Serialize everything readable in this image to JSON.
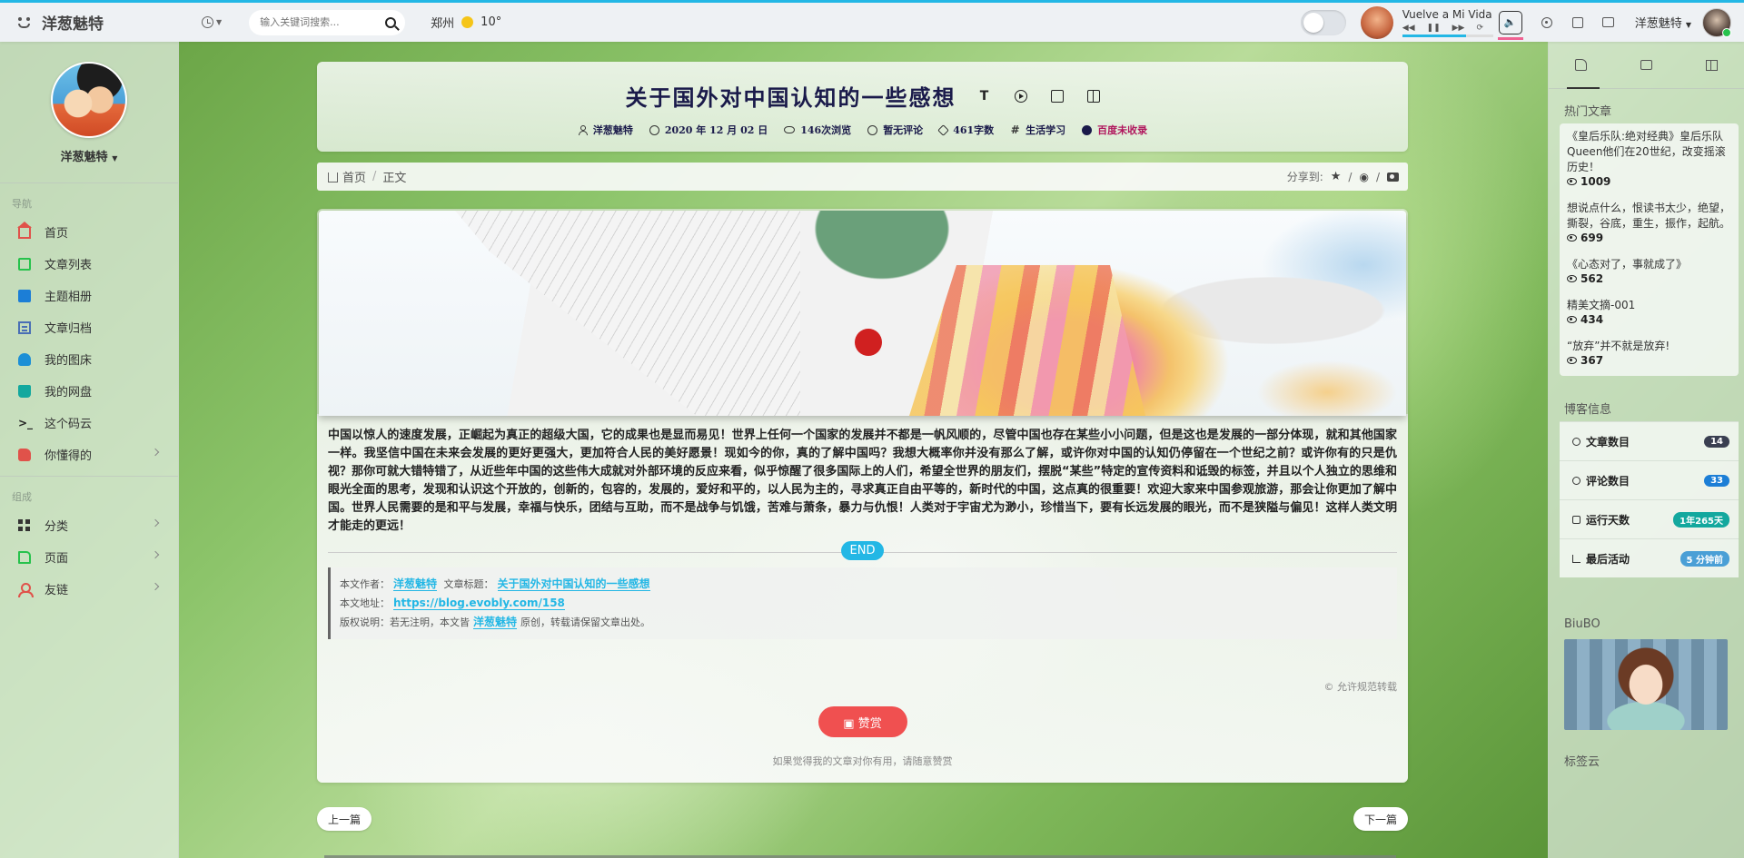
{
  "topbar": {
    "brand": "洋葱魅特",
    "search_placeholder": "输入关键词搜索...",
    "weather_city": "郑州",
    "weather_temp": "10°",
    "music_title": "Vuelve a Mi Vida",
    "user_name": "洋葱魅特"
  },
  "sidebar": {
    "profile_name": "洋葱魅特",
    "nav_label": "导航",
    "nav_items": [
      {
        "label": "首页"
      },
      {
        "label": "文章列表"
      },
      {
        "label": "主题相册"
      },
      {
        "label": "文章归档"
      },
      {
        "label": "我的图床"
      },
      {
        "label": "我的网盘"
      },
      {
        "label": "这个码云"
      },
      {
        "label": "你懂得的"
      }
    ],
    "group_label": "组成",
    "group_items": [
      {
        "label": "分类"
      },
      {
        "label": "页面"
      },
      {
        "label": "友链"
      }
    ]
  },
  "post": {
    "title": "关于国外对中国认知的一些感想",
    "meta": {
      "author": "洋葱魅特",
      "date": "2020 年 12 月 02 日",
      "views": "146次浏览",
      "comments": "暂无评论",
      "words": "461字数",
      "category": "生活学习",
      "baidu": "百度未收录"
    },
    "breadcrumb": {
      "home": "首页",
      "current": "正文"
    },
    "share_label": "分享到:",
    "body": "中国以惊人的速度发展，正崛起为真正的超级大国，它的成果也是显而易见！世界上任何一个国家的发展并不都是一帆风顺的，尽管中国也存在某些小小问题，但是这也是发展的一部分体现，就和其他国家一样。我坚信中国在未来会发展的更好更强大，更加符合人民的美好愿景！现如今的你，真的了解中国吗？我想大概率你并没有那么了解，或许你对中国的认知仍停留在一个世纪之前？或许你有的只是仇视？那你可就大错特错了，从近些年中国的这些伟大成就对外部环境的反应来看，似乎惊醒了很多国际上的人们，希望全世界的朋友们，摆脱“某些”特定的宣传资料和诋毁的标签，并且以个人独立的思维和眼光全面的思考，发现和认识这个开放的，创新的，包容的，发展的，爱好和平的，以人民为主的，寻求真正自由平等的，新时代的中国，这点真的很重要！欢迎大家来中国参观旅游，那会让你更加了解中国。世界人民需要的是和平与发展，幸福与快乐，团结与互助，而不是战争与饥饿，苦难与萧条，暴力与仇恨！人类对于宇宙尤为渺小，珍惜当下，要有长远发展的眼光，而不是狭隘与偏见！这样人类文明才能走的更远！",
    "end_label": "END",
    "copyright": {
      "author_label": "本文作者：",
      "author": "洋葱魅特",
      "title_label": "文章标题：",
      "title": "关于国外对中国认知的一些感想",
      "url_label": "本文地址：",
      "url": "https://blog.evobly.com/158",
      "license_label": "版权说明：若无注明，本文皆",
      "license_author": "洋葱魅特",
      "license_tail": "原创，转载请保留文章出处。"
    },
    "license_note": "© 允许规范转载",
    "reward_label": "赞赏",
    "reward_tip": "如果觉得我的文章对你有用，请随意赞赏",
    "prev_label": "上一篇",
    "next_label": "下一篇"
  },
  "rsidebar": {
    "hot_title": "热门文章",
    "hot_items": [
      {
        "title": "《皇后乐队:绝对经典》皇后乐队Queen他们在20世纪，改变摇滚历史！",
        "views": "1009"
      },
      {
        "title": "想说点什么，恨读书太少，绝望，撕裂，谷底，重生，振作，起航。",
        "views": "699"
      },
      {
        "title": "《心态对了，事就成了》",
        "views": "562"
      },
      {
        "title": "精美文摘-001",
        "views": "434"
      },
      {
        "title": "“放弃”并不就是放弃!",
        "views": "367"
      }
    ],
    "info_title": "博客信息",
    "info_items": [
      {
        "label": "文章数目",
        "value": "14",
        "color": "#3a3f51"
      },
      {
        "label": "评论数目",
        "value": "33",
        "color": "#1c7ed6"
      },
      {
        "label": "运行天数",
        "value": "1年265天",
        "color": "#13a89e"
      },
      {
        "label": "最后活动",
        "value": "5 分钟前",
        "color": "#4a9fd6"
      }
    ],
    "biubo_title": "BiuBO",
    "tags_title": "标签云"
  }
}
